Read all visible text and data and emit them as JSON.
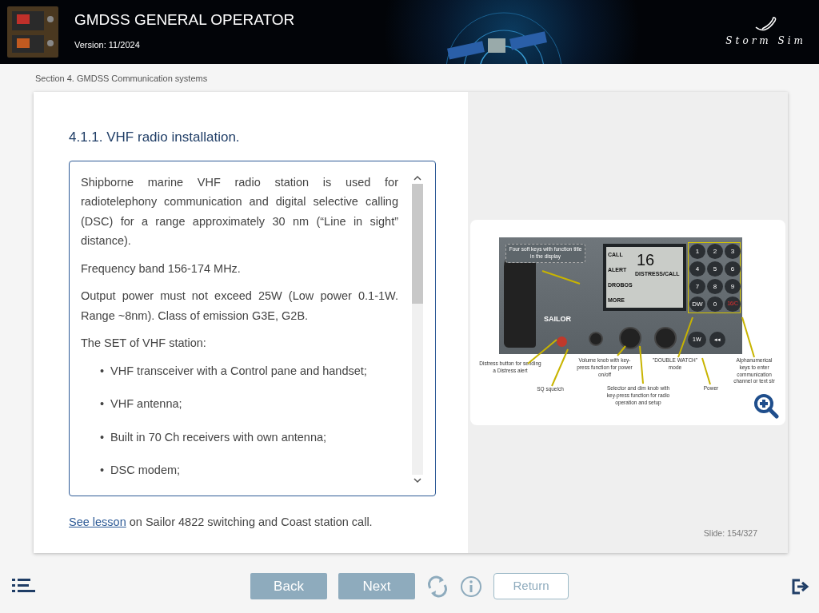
{
  "header": {
    "title": "GMDSS GENERAL OPERATOR",
    "version": "Version: 11/2024",
    "brand": "Storm Sim"
  },
  "breadcrumb": "Section 4. GMDSS Communication systems",
  "lesson": {
    "heading": "4.1.1. VHF radio installation.",
    "paragraphs": [
      "Shipborne marine VHF radio station is used for radiotelephony communication and digital selective calling (DSC) for a range approximately 30 nm (“Line in sight” distance).",
      "Frequency band 156-174 MHz.",
      "Output power must not exceed 25W (Low power 0.1-1W. Range ~8nm). Class of emission G3E, G2B.",
      "The SET of VHF station:"
    ],
    "marker": "•",
    "bullets": [
      "VHF transceiver with a Control pane and handset;",
      "VHF antenna;",
      "Built in 70 Ch receivers with own antenna;",
      "DSC modem;"
    ],
    "link": {
      "text": " See lesson",
      "rest": " on Sailor 4822 switching and Coast station call."
    }
  },
  "figure": {
    "soft_keys": [
      "CALL",
      "ALERT",
      "DROBOS",
      "MORE"
    ],
    "channel": "16",
    "status": "DISTRESS/CALL",
    "brand": "SAILOR",
    "keys": [
      "1",
      "2",
      "3",
      "4",
      "5",
      "6",
      "7",
      "8",
      "9",
      "DW",
      "0",
      "16/C"
    ],
    "bottom_keys": [
      "1W",
      "◂◂"
    ],
    "callouts": [
      {
        "text": "Four soft keys with function title in the display",
        "kind": "boxed"
      },
      {
        "text": "Distress button for sending a Distress alert",
        "kind": "plain"
      },
      {
        "text": "SQ squelch",
        "kind": "plain"
      },
      {
        "text": "Volume knob with key-press function for power on/off",
        "kind": "plain"
      },
      {
        "text": "Selector and dim knob with key-press function for radio operation and setup",
        "kind": "plain"
      },
      {
        "text": "\"DOUBLE WATCH\" mode",
        "kind": "plain"
      },
      {
        "text": "Power",
        "kind": "plain"
      },
      {
        "text": "Alphanumerical keys to enter communication channel or text str",
        "kind": "plain"
      }
    ]
  },
  "slide": "Slide:  154/327",
  "footer": {
    "buttons": [
      {
        "label": "Back",
        "kind": "filled"
      },
      {
        "label": "Next",
        "kind": "filled"
      },
      {
        "label": "Return",
        "kind": "outline"
      }
    ]
  }
}
